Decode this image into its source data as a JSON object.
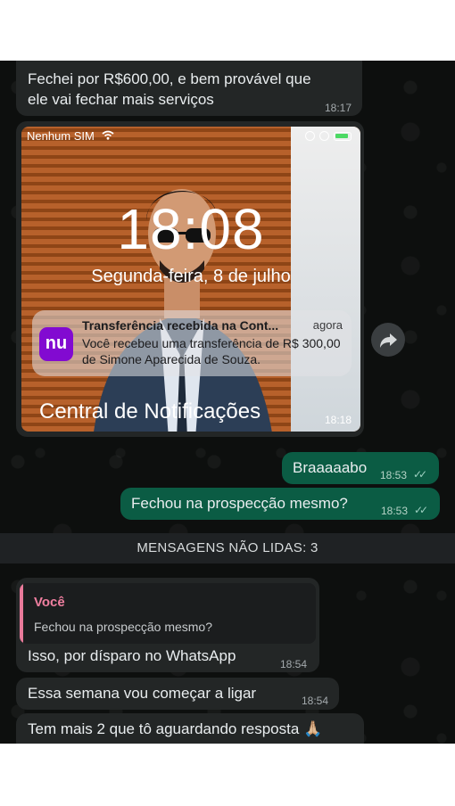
{
  "messages": {
    "m1": {
      "text_line1": "Fechei por R$600,00, e bem provável que",
      "text_line2": "ele vai fechar mais serviços",
      "time": "18:17"
    },
    "screenshot": {
      "status_carrier": "Nenhum SIM",
      "clock": "18:08",
      "date": "Segunda-feira, 8 de julho",
      "notification": {
        "app_icon_text": "nu",
        "title": "Transferência recebida na Cont...",
        "when": "agora",
        "body": "Você recebeu uma transferência de R$ 300,00 de Simone Aparecida de Souza."
      },
      "footer": "Central de Notificações",
      "time": "18:18"
    },
    "m2": {
      "text": "Braaaaabo",
      "time": "18:53"
    },
    "m3": {
      "text": "Fechou na prospecção mesmo?",
      "time": "18:53"
    },
    "unread_banner": "MENSAGENS NÃO LIDAS: 3",
    "m4": {
      "quote_author": "Você",
      "quote_text": "Fechou na prospecção mesmo?",
      "text": "Isso, por dísparo no WhatsApp",
      "time": "18:54"
    },
    "m5": {
      "text": "Essa semana vou começar a ligar",
      "time": "18:54"
    },
    "m6": {
      "text": "Tem mais 2 que tô aguardando resposta 🙏🏼"
    }
  },
  "colors": {
    "incoming": "#232626",
    "outgoing": "#0b5c44",
    "quote_accent": "#e97a9a",
    "nubank": "#820ad1"
  },
  "icons": [
    "wifi-icon",
    "forward-icon",
    "double-check-icon",
    "alarm-icon",
    "battery-icon",
    "rotation-lock-icon"
  ]
}
